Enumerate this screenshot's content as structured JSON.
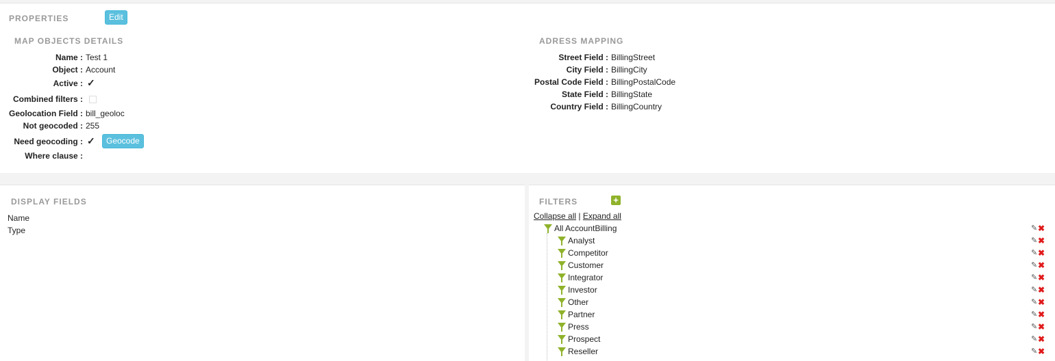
{
  "properties": {
    "title": "PROPERTIES",
    "edit_label": "Edit",
    "map_objects": {
      "title": "MAP OBJECTS DETAILS",
      "name_label": "Name :",
      "name_value": "Test 1",
      "object_label": "Object :",
      "object_value": "Account",
      "active_label": "Active :",
      "active_checked": true,
      "combined_label": "Combined filters :",
      "combined_checked": false,
      "geoloc_label": "Geolocation Field :",
      "geoloc_value": "bill_geoloc",
      "notgeo_label": "Not geocoded :",
      "notgeo_value": "255",
      "needgeo_label": "Need geocoding :",
      "needgeo_checked": true,
      "geocode_button": "Geocode",
      "where_label": "Where clause :",
      "where_value": ""
    },
    "address_mapping": {
      "title": "ADRESS MAPPING",
      "street_label": "Street Field :",
      "street_value": "BillingStreet",
      "city_label": "City Field :",
      "city_value": "BillingCity",
      "postal_label": "Postal Code Field :",
      "postal_value": "BillingPostalCode",
      "state_label": "State Field :",
      "state_value": "BillingState",
      "country_label": "Country Field :",
      "country_value": "BillingCountry"
    }
  },
  "display_fields": {
    "title": "DISPLAY FIELDS",
    "items": [
      "Name",
      "Type"
    ]
  },
  "filters": {
    "title": "FILTERS",
    "collapse_all": "Collapse all",
    "separator": "|",
    "expand_all": "Expand all",
    "root": "All AccountBilling",
    "children": [
      "Analyst",
      "Competitor",
      "Customer",
      "Integrator",
      "Investor",
      "Other",
      "Partner",
      "Press",
      "Prospect",
      "Reseller"
    ],
    "icon_names": {
      "filter": "filter-funnel-icon",
      "add": "plus-icon",
      "edit": "edit-icon",
      "delete": "delete-icon"
    },
    "colors": {
      "accent_green": "#8fb22b",
      "delete_red": "#e01a1a",
      "button_blue": "#5bc0de"
    }
  }
}
